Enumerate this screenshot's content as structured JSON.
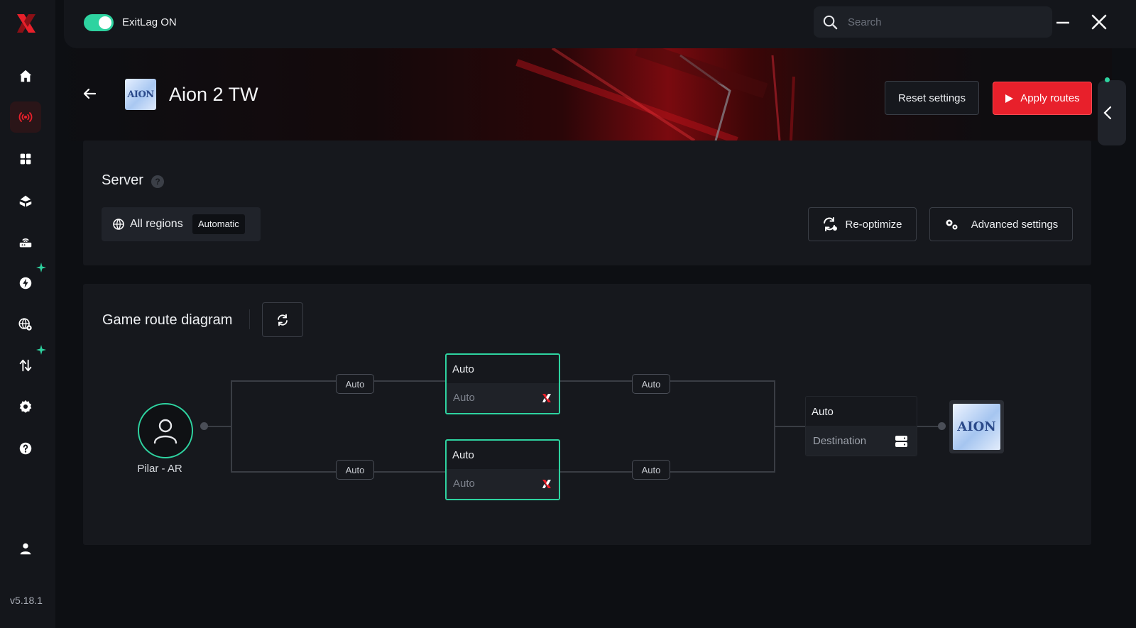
{
  "app": {
    "version": "v5.18.1",
    "toggle_label": "ExitLag ON",
    "toggle_on": true,
    "accent_color": "#2ed3a0",
    "brand_color": "#e8202b"
  },
  "search": {
    "placeholder": "Search",
    "value": ""
  },
  "sidebar": {
    "items": [
      {
        "icon": "home-icon"
      },
      {
        "icon": "routes-broadcast-icon",
        "active": true
      },
      {
        "icon": "apps-grid-icon"
      },
      {
        "icon": "boost-icon"
      },
      {
        "icon": "router-icon"
      },
      {
        "icon": "bolt-icon",
        "sparkle": true
      },
      {
        "icon": "globe-settings-icon"
      },
      {
        "icon": "transfer-arrows-icon",
        "sparkle": true
      },
      {
        "icon": "gear-icon"
      },
      {
        "icon": "help-icon"
      }
    ],
    "profile_icon": "user-icon"
  },
  "header": {
    "title": "Aion 2 TW",
    "game_icon_text": "AION",
    "reset_label": "Reset settings",
    "apply_label": "Apply routes"
  },
  "server": {
    "title": "Server",
    "region_label": "All regions",
    "mode_badge": "Automatic",
    "reoptimize_label": "Re-optimize",
    "advanced_label": "Advanced settings"
  },
  "route": {
    "title": "Game route diagram",
    "origin_label": "Pilar - AR",
    "links": [
      "Auto",
      "Auto",
      "Auto",
      "Auto"
    ],
    "nodes": [
      {
        "top": "Auto",
        "bottom": "Auto"
      },
      {
        "top": "Auto",
        "bottom": "Auto"
      }
    ],
    "destination": {
      "top": "Auto",
      "bottom": "Destination"
    },
    "game_icon_text": "AION"
  }
}
